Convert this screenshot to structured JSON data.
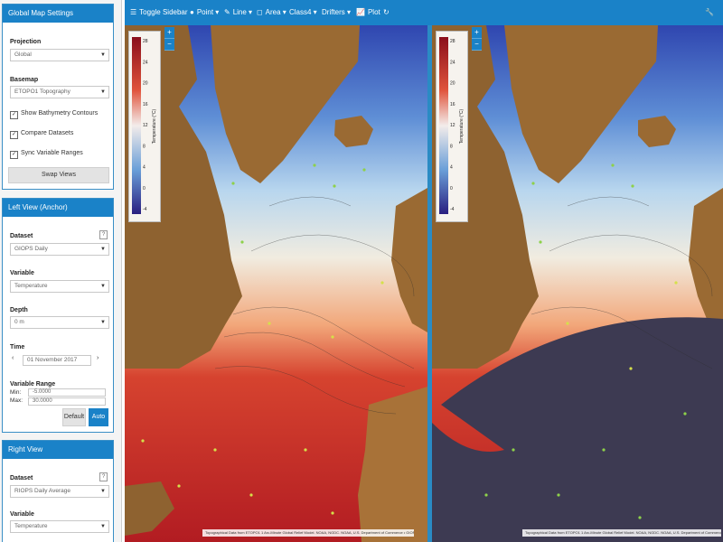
{
  "sidebar": {
    "global": {
      "title": "Global Map Settings",
      "projection_label": "Projection",
      "projection_value": "Global",
      "basemap_label": "Basemap",
      "basemap_value": "ETOPO1 Topography",
      "checks": [
        {
          "label": "Show Bathymetry Contours",
          "checked": true
        },
        {
          "label": "Compare Datasets",
          "checked": true
        },
        {
          "label": "Sync Variable Ranges",
          "checked": true
        }
      ],
      "swap_label": "Swap Views"
    },
    "left_view": {
      "title": "Left View (Anchor)",
      "dataset_label": "Dataset",
      "dataset_value": "GIOPS Daily",
      "variable_label": "Variable",
      "variable_value": "Temperature",
      "depth_label": "Depth",
      "depth_value": "0 m",
      "time_label": "Time",
      "time_value": "01 November 2017",
      "range_label": "Variable Range",
      "min_label": "Min:",
      "min_value": "-5.0000",
      "max_label": "Max:",
      "max_value": "30.0000",
      "default_label": "Default",
      "auto_label": "Auto"
    },
    "right_view": {
      "title": "Right View",
      "dataset_label": "Dataset",
      "dataset_value": "RIOPS Daily Average",
      "variable_label": "Variable",
      "variable_value": "Temperature"
    }
  },
  "toolbar": {
    "toggle": "Toggle Sidebar",
    "point": "Point",
    "line": "Line",
    "area": "Area",
    "class4": "Class4",
    "drifters": "Drifters",
    "plot": "Plot"
  },
  "colorbar": {
    "ticks": [
      "28",
      "24",
      "20",
      "16",
      "12",
      "8",
      "4",
      "0",
      "-4"
    ],
    "title": "Temperature (°C)"
  },
  "attribution": "Topographical Data from ETOPO1 1 Arc-Minute Global Relief Model. NOAA, NGDC. NOAA, U.S. Department of Commerce • GIOPS Daily Values from CONCEPTS",
  "colors": {
    "accent": "#1a82c8",
    "warm": "#c0202a",
    "cold": "#3040a8",
    "land": "#9a6a33",
    "mask": "#3d3a52"
  },
  "icons": [
    "menu-icon",
    "point-icon",
    "pencil-icon",
    "area-icon",
    "chart-icon",
    "refresh-icon",
    "wrench-icon"
  ]
}
